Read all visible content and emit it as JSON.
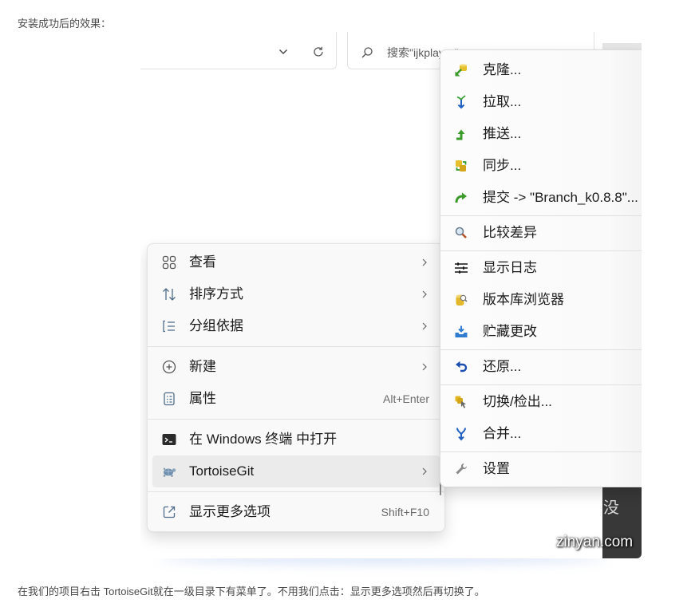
{
  "document": {
    "caption_top": "安装成功后的效果：",
    "caption_bottom": "在我们的项目右击 TortoiseGit就在一级目录下有菜单了。不用我们点击：显示更多选项然后再切换了。",
    "watermark": "zinyan.com"
  },
  "explorer": {
    "address_bar": {
      "dropdown_icon": "chevron-down-icon",
      "refresh_icon": "refresh-icon"
    },
    "search": {
      "placeholder": "搜索\"ijkplayer\"",
      "icon": "search-icon"
    },
    "background_window_text": "没"
  },
  "context_menu": {
    "highlight_color": "#ebebeb",
    "items": [
      {
        "label": "查看",
        "icon": "view-grid-icon",
        "has_submenu": true
      },
      {
        "label": "排序方式",
        "icon": "sort-icon",
        "has_submenu": true
      },
      {
        "label": "分组依据",
        "icon": "group-by-icon",
        "has_submenu": true
      },
      {
        "label": "新建",
        "icon": "new-icon",
        "has_submenu": true
      },
      {
        "label": "属性",
        "icon": "properties-icon",
        "shortcut": "Alt+Enter"
      },
      {
        "label": "在 Windows 终端 中打开",
        "icon": "terminal-icon"
      },
      {
        "label": "TortoiseGit",
        "icon": "tortoisegit-icon",
        "has_submenu": true,
        "highlighted": true
      },
      {
        "label": "显示更多选项",
        "icon": "more-options-icon",
        "shortcut": "Shift+F10"
      }
    ]
  },
  "tortoisegit_submenu": {
    "items": [
      {
        "label": "克隆...",
        "icon": "clone-icon"
      },
      {
        "label": "拉取...",
        "icon": "pull-icon"
      },
      {
        "label": "推送...",
        "icon": "push-icon"
      },
      {
        "label": "同步...",
        "icon": "sync-icon"
      },
      {
        "label": "提交 -> \"Branch_k0.8.8\"...",
        "icon": "commit-icon"
      },
      {
        "label": "比较差异",
        "icon": "diff-icon"
      },
      {
        "label": "显示日志",
        "icon": "log-icon"
      },
      {
        "label": "版本库浏览器",
        "icon": "repo-browser-icon"
      },
      {
        "label": "贮藏更改",
        "icon": "stash-icon"
      },
      {
        "label": "还原...",
        "icon": "revert-icon"
      },
      {
        "label": "切换/检出...",
        "icon": "switch-checkout-icon"
      },
      {
        "label": "合并...",
        "icon": "merge-icon"
      },
      {
        "label": "设置",
        "icon": "settings-icon"
      }
    ]
  }
}
